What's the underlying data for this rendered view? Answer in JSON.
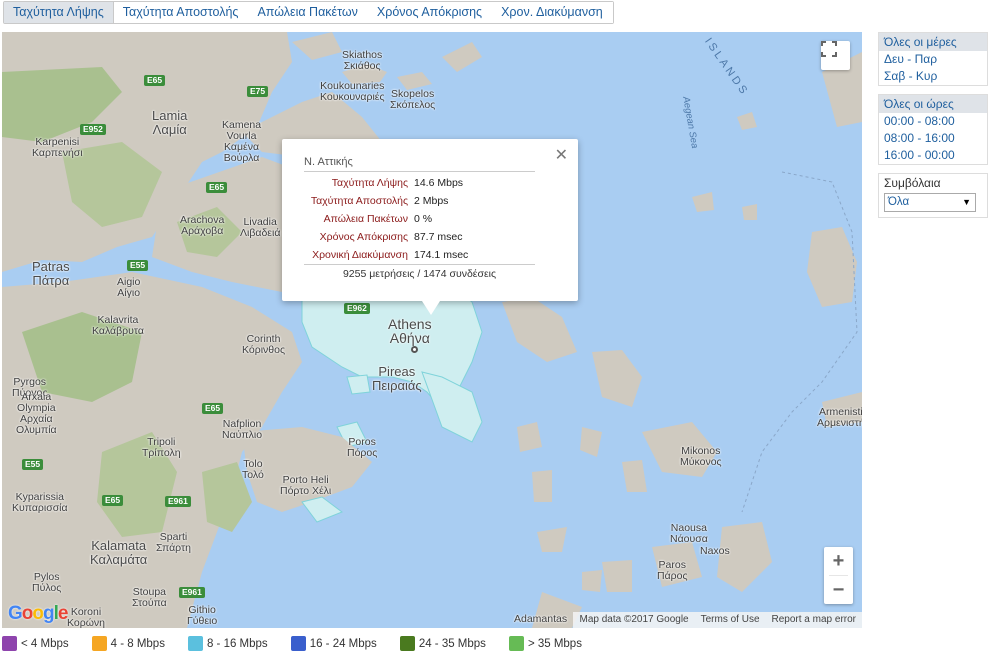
{
  "tabs": [
    "Ταχύτητα Λήψης",
    "Ταχύτητα Αποστολής",
    "Απώλεια Πακέτων",
    "Χρόνος Απόκρισης",
    "Χρον. Διακύμανση"
  ],
  "popup": {
    "region": "Ν. Αττικής",
    "rows": [
      {
        "k": "Ταχύτητα Λήψης",
        "v": "14.6 Mbps"
      },
      {
        "k": "Ταχύτητα Αποστολής",
        "v": "2 Mbps"
      },
      {
        "k": "Απώλεια Πακέτων",
        "v": "0 %"
      },
      {
        "k": "Χρόνος Απόκρισης",
        "v": "87.7 msec"
      },
      {
        "k": "Χρονική Διακύμανση",
        "v": "174.1 msec"
      }
    ],
    "summary": "9255 μετρήσεις / 1474 συνδέσεις",
    "close": "✕"
  },
  "days": {
    "title": "Όλες οι μέρες",
    "items": [
      "Δευ - Παρ",
      "Σαβ - Κυρ"
    ]
  },
  "hours": {
    "title": "Όλες οι ώρες",
    "items": [
      "00:00 - 08:00",
      "08:00 - 16:00",
      "16:00 - 00:00"
    ]
  },
  "contracts": {
    "title": "Συμβόλαια",
    "selected": "Όλα"
  },
  "legend": [
    {
      "label": "< 4 Mbps",
      "color": "#8e44ad"
    },
    {
      "label": "4 - 8 Mbps",
      "color": "#f5a623"
    },
    {
      "label": "8 - 16 Mbps",
      "color": "#5bc0de"
    },
    {
      "label": "16 - 24 Mbps",
      "color": "#3a5fcd"
    },
    {
      "label": "24 - 35 Mbps",
      "color": "#4a7a1f"
    },
    {
      "label": "> 35 Mbps",
      "color": "#66bb55"
    }
  ],
  "map": {
    "attribution": [
      "Map data ©2017 Google",
      "Terms of Use",
      "Report a map error"
    ],
    "logo": [
      "G",
      "o",
      "o",
      "g",
      "l",
      "e"
    ],
    "zoom_in": "+",
    "zoom_out": "−",
    "places": [
      {
        "t": "Skiathos\nΣκιάθος"
      },
      {
        "t": "Koukounaries\nΚουκουναριές"
      },
      {
        "t": "Skopelos\nΣκόπελος"
      },
      {
        "t": "Lamia\nΛαμία"
      },
      {
        "t": "Karpenisi\nΚαρπενήσι"
      },
      {
        "t": "Kamena\nVourla\nΚαμένα\nΒούρλα"
      },
      {
        "t": "Arachova\nΑράχοβα"
      },
      {
        "t": "Livadia\nΛιβαδειά"
      },
      {
        "t": "Patras\nΠάτρα"
      },
      {
        "t": "Aigio\nΑίγιο"
      },
      {
        "t": "Kalavrita\nΚαλάβρυτα"
      },
      {
        "t": "Corinth\nΚόρινθος"
      },
      {
        "t": "Athens\nΑθήνα"
      },
      {
        "t": "Pireas\nΠειραιάς"
      },
      {
        "t": "Pyrgos\nΠύργος"
      },
      {
        "t": "Arxaia\nOlympia\nΑρχαία\nΟλυμπία"
      },
      {
        "t": "Nafplion\nΝαύπλιο"
      },
      {
        "t": "Tripoli\nΤρίπολη"
      },
      {
        "t": "Poros\nΠόρος"
      },
      {
        "t": "Tolo\nΤολό"
      },
      {
        "t": "Porto Heli\nΠόρτο Χέλι"
      },
      {
        "t": "Kyparissia\nΚυπαρισσία"
      },
      {
        "t": "Kalamata\nΚαλαμάτα"
      },
      {
        "t": "Sparti\nΣπάρτη"
      },
      {
        "t": "Pylos\nΠύλος"
      },
      {
        "t": "Koroni\nΚορώνη"
      },
      {
        "t": "Stoupa\nΣτούπα"
      },
      {
        "t": "Githio\nΓύθειο"
      },
      {
        "t": "Mikonos\nΜύκονος"
      },
      {
        "t": "Naousa\nΝάουσα"
      },
      {
        "t": "Paros\nΠάρος"
      },
      {
        "t": "Naxos"
      },
      {
        "t": "Adamantas"
      },
      {
        "t": "Armenisti\nΑρμενιστή"
      },
      {
        "t": "Aegean Sea"
      },
      {
        "t": "ISLANDS"
      }
    ],
    "roads": [
      "E65",
      "E75",
      "E952",
      "E65",
      "E55",
      "E962",
      "E65",
      "E55",
      "E65",
      "E961",
      "E961"
    ]
  }
}
